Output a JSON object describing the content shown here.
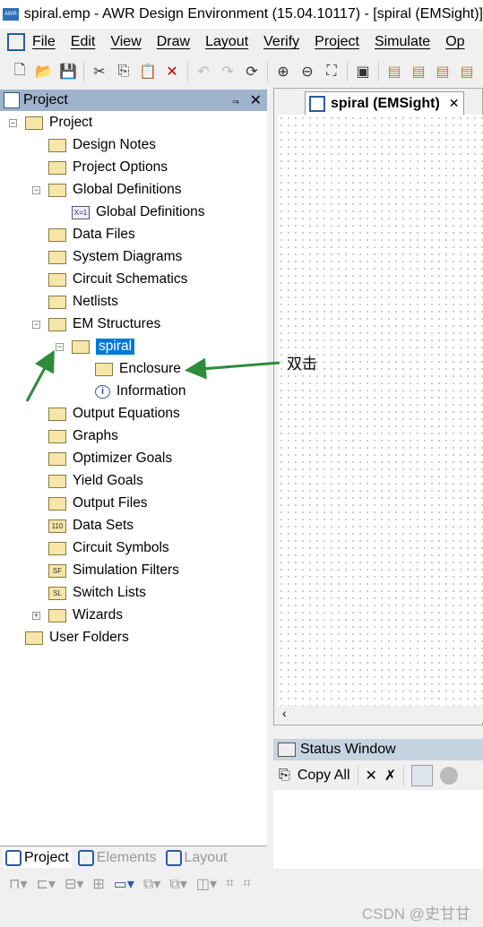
{
  "window": {
    "title": "spiral.emp - AWR Design Environment (15.04.10117) - [spiral (EMSight)]"
  },
  "menu": [
    "File",
    "Edit",
    "View",
    "Draw",
    "Layout",
    "Verify",
    "Project",
    "Simulate",
    "Op"
  ],
  "toolbar_icons": [
    "new-icon",
    "open-icon",
    "save-icon",
    "cut-icon",
    "copy-icon",
    "paste-icon",
    "delete-icon",
    "undo-icon",
    "redo-icon",
    "refresh-icon",
    "zoom-in-icon",
    "zoom-out-icon",
    "fit-icon",
    "new-window-icon",
    "add-port-icon",
    "add-element-icon",
    "add-element2-icon",
    "add-element3-icon"
  ],
  "project_panel": {
    "title": "Project",
    "pin": "⫬",
    "close": "✕"
  },
  "tree": [
    {
      "label": "Project",
      "level": 0,
      "exp": "-"
    },
    {
      "label": "Design Notes",
      "level": 1
    },
    {
      "label": "Project Options",
      "level": 1
    },
    {
      "label": "Global Definitions",
      "level": 1,
      "exp": "-"
    },
    {
      "label": "Global Definitions",
      "level": 2,
      "icon": "X=1"
    },
    {
      "label": "Data Files",
      "level": 1
    },
    {
      "label": "System Diagrams",
      "level": 1
    },
    {
      "label": "Circuit Schematics",
      "level": 1
    },
    {
      "label": "Netlists",
      "level": 1
    },
    {
      "label": "EM Structures",
      "level": 1,
      "exp": "-"
    },
    {
      "label": "spiral",
      "level": 2,
      "exp": "-",
      "selected": true
    },
    {
      "label": "Enclosure",
      "level": 3
    },
    {
      "label": "Information",
      "level": 3,
      "icon": "i"
    },
    {
      "label": "Output Equations",
      "level": 1
    },
    {
      "label": "Graphs",
      "level": 1
    },
    {
      "label": "Optimizer Goals",
      "level": 1
    },
    {
      "label": "Yield Goals",
      "level": 1
    },
    {
      "label": "Output Files",
      "level": 1
    },
    {
      "label": "Data Sets",
      "level": 1,
      "icon": "110"
    },
    {
      "label": "Circuit Symbols",
      "level": 1
    },
    {
      "label": "Simulation Filters",
      "level": 1,
      "icon": "SF"
    },
    {
      "label": "Switch Lists",
      "level": 1,
      "icon": "SL"
    },
    {
      "label": "Wizards",
      "level": 1,
      "exp": "+"
    },
    {
      "label": "User Folders",
      "level": 0
    }
  ],
  "document_tab": {
    "label": "spiral (EMSight)",
    "close": "✕"
  },
  "status_window": {
    "title": "Status Window",
    "copy_all": "Copy All"
  },
  "bottom_tabs": [
    {
      "label": "Project",
      "active": true
    },
    {
      "label": "Elements"
    },
    {
      "label": "Layout"
    }
  ],
  "annotation": {
    "text": "双击",
    "color": "#2e8b3a"
  },
  "watermark": "CSDN @史甘甘"
}
